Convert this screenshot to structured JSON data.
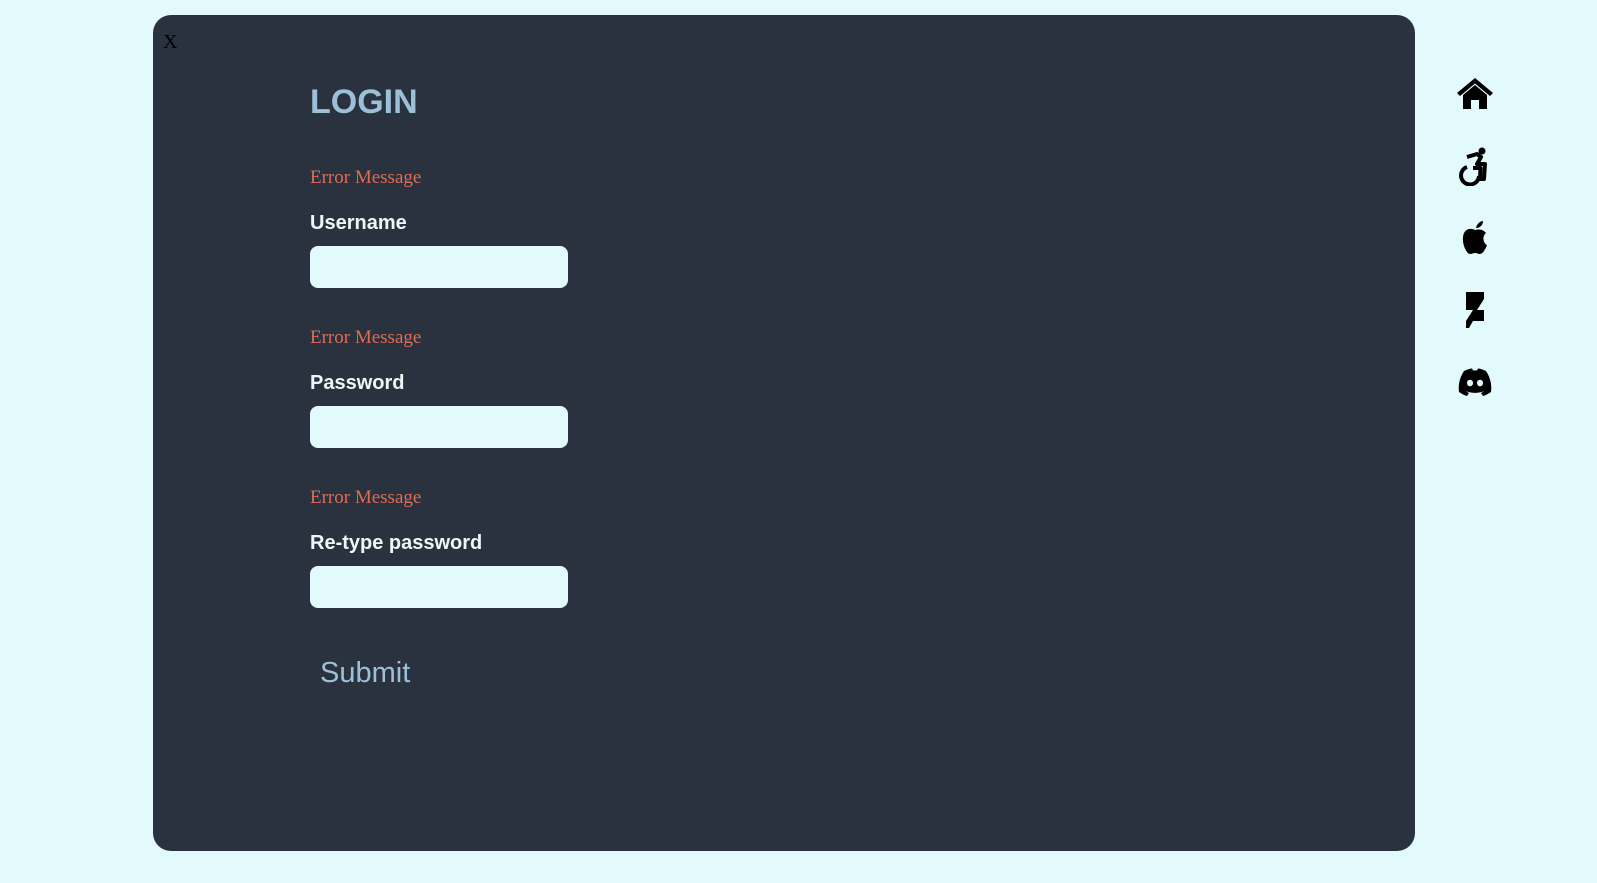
{
  "modal": {
    "close_label": "X",
    "title": "LOGIN",
    "fields": [
      {
        "error": "Error Message",
        "label": "Username",
        "value": ""
      },
      {
        "error": "Error Message",
        "label": "Password",
        "value": ""
      },
      {
        "error": "Error Message",
        "label": "Re-type password",
        "value": ""
      }
    ],
    "submit_label": "Submit"
  },
  "sidebar": {
    "icons": [
      "home-icon",
      "accessibility-icon",
      "apple-icon",
      "deviantart-icon",
      "discord-icon"
    ]
  },
  "colors": {
    "background": "#e3fafd",
    "panel": "#2a3240",
    "title": "#9dc0d9",
    "error": "#e06c52"
  }
}
